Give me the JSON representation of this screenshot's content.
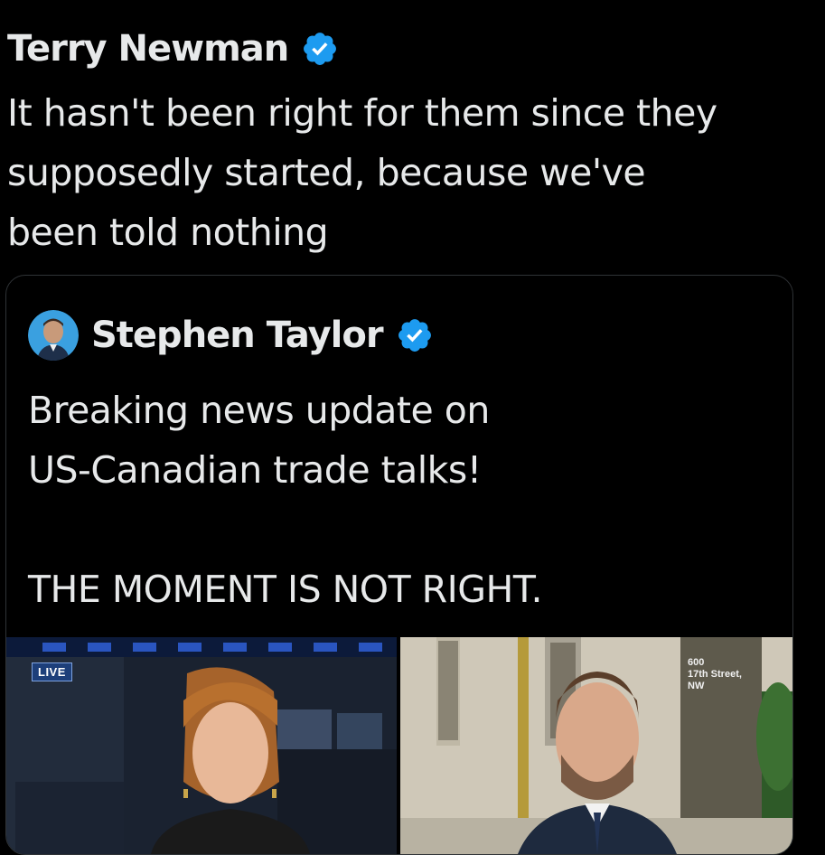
{
  "tweet": {
    "author_name": "Terry Newman",
    "verified_icon": "verified-badge-icon",
    "text": "It hasn't been right for them since they\nsupposedly started, because we've\nbeen told nothing"
  },
  "quoted_tweet": {
    "author_name": "Stephen Taylor",
    "verified_icon": "verified-badge-icon",
    "text": "Breaking news update on\nUS-Canadian trade talks!\n\nTHE MOMENT IS NOT RIGHT.",
    "media": {
      "left_badge": "LIVE",
      "right_sign": "600\n17th Street,\nNW"
    }
  },
  "colors": {
    "background": "#000000",
    "text": "#e7e9ea",
    "verified_blue": "#1d9bf0",
    "card_border": "#2f3336"
  }
}
